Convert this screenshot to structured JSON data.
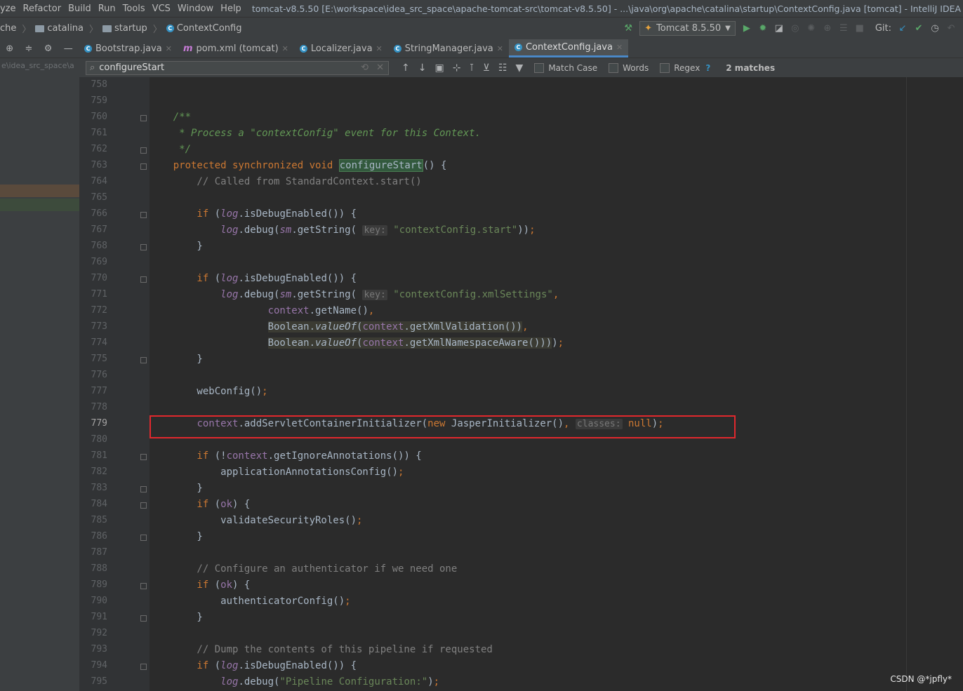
{
  "menu": {
    "items": [
      "yze",
      "Refactor",
      "Build",
      "Run",
      "Tools",
      "VCS",
      "Window",
      "Help"
    ],
    "window_title": "tomcat-v8.5.50 [E:\\workspace\\idea_src_space\\apache-tomcat-src\\tomcat-v8.5.50] - ...\\java\\org\\apache\\catalina\\startup\\ContextConfig.java [tomcat] - IntelliJ IDEA"
  },
  "nav": {
    "crumbs": [
      "che",
      "catalina",
      "startup",
      "ContextConfig"
    ],
    "run_config": "Tomcat 8.5.50",
    "git_label": "Git:"
  },
  "tabs": [
    {
      "label": "Bootstrap.java",
      "icon": "java-class-icon"
    },
    {
      "label": "pom.xml (tomcat)",
      "icon": "maven-icon"
    },
    {
      "label": "Localizer.java",
      "icon": "java-class-icon"
    },
    {
      "label": "StringManager.java",
      "icon": "java-class-icon"
    },
    {
      "label": "ContextConfig.java",
      "icon": "java-class-icon",
      "active": true
    }
  ],
  "project_pane": {
    "path": "e\\idea_src_space\\a"
  },
  "find": {
    "query": "configureStart",
    "match_case": "Match Case",
    "words": "Words",
    "regex": "Regex",
    "help": "?",
    "matches": "2 matches"
  },
  "editor": {
    "line_numbers": [
      "758",
      "759",
      "760",
      "761",
      "762",
      "763",
      "764",
      "765",
      "766",
      "767",
      "768",
      "769",
      "770",
      "771",
      "772",
      "773",
      "774",
      "775",
      "776",
      "777",
      "778",
      "779",
      "780",
      "781",
      "782",
      "783",
      "784",
      "785",
      "786",
      "787",
      "788",
      "789",
      "790",
      "791",
      "792",
      "793",
      "794",
      "795"
    ],
    "current_line": "779",
    "highlighted_line": "779"
  },
  "watermark": "CSDN @*jpfly*"
}
